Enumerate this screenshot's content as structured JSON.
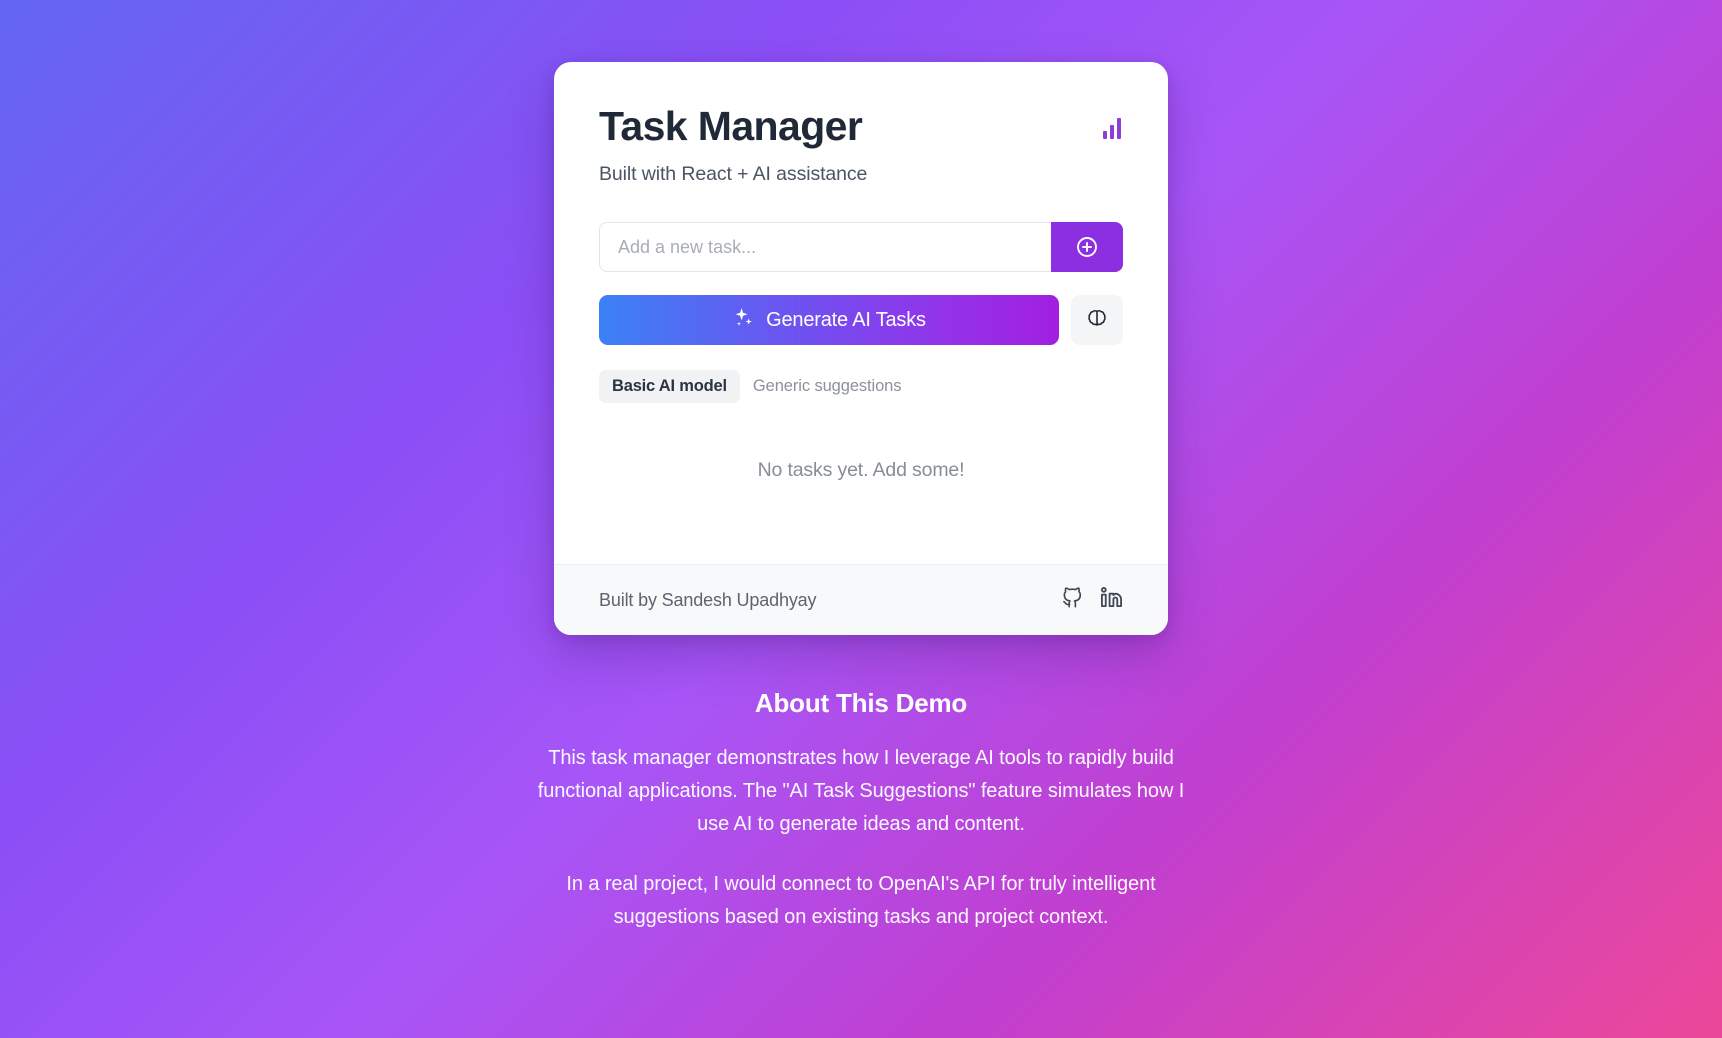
{
  "card": {
    "title": "Task Manager",
    "subtitle": "Built with React + AI assistance",
    "chart_icon_name": "bar-chart-icon",
    "input": {
      "placeholder": "Add a new task...",
      "value": ""
    },
    "add_button_label": "",
    "generate_button_label": "Generate AI Tasks",
    "brain_button_label": "",
    "model_badge": "Basic AI model",
    "model_note": "Generic suggestions",
    "empty_state": "No tasks yet. Add some!",
    "footer": {
      "credit": "Built by Sandesh Upadhyay",
      "github_label": "GitHub",
      "linkedin_label": "LinkedIn"
    }
  },
  "about": {
    "title": "About This Demo",
    "paragraph_1": "This task manager demonstrates how I leverage AI tools to rapidly build functional applications. The \"AI Task Suggestions\" feature simulates how I use AI to generate ideas and content.",
    "paragraph_2": "In a real project, I would connect to OpenAI's API for truly intelligent suggestions based on existing tasks and project context."
  },
  "colors": {
    "background_start": "#6366f1",
    "background_mid": "#a855f7",
    "background_end": "#ec4899",
    "accent_purple": "#8b2fe0",
    "gradient_button_start": "#3b82f6",
    "gradient_button_end": "#a21fe0",
    "chart_icon": "#8b3fd6"
  }
}
